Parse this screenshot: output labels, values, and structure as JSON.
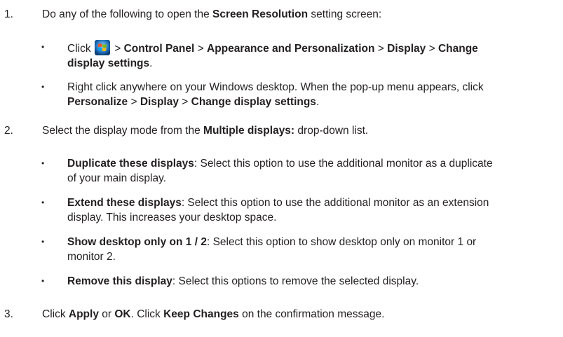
{
  "steps": [
    {
      "num": "1.",
      "pre": "Do any of the following to open the ",
      "bold": "Screen Resolution",
      "post": " setting screen:",
      "bullets": [
        {
          "lines": [
            [
              {
                "t": "Click ",
                "b": false
              },
              {
                "icon": "windows-start-icon"
              },
              {
                "t": " > ",
                "b": false
              },
              {
                "t": "Control Panel",
                "b": true
              },
              {
                "t": " > ",
                "b": false
              },
              {
                "t": "Appearance and Personalization",
                "b": true
              },
              {
                "t": " > ",
                "b": false
              },
              {
                "t": "Display",
                "b": true
              },
              {
                "t": " > ",
                "b": false
              },
              {
                "t": "Change",
                "b": true
              }
            ],
            [
              {
                "t": "display settings",
                "b": true
              },
              {
                "t": ".",
                "b": false
              }
            ]
          ]
        },
        {
          "lines": [
            [
              {
                "t": "Right click anywhere on your Windows desktop. When the pop-up menu appears, click",
                "b": false
              }
            ],
            [
              {
                "t": "Personalize",
                "b": true
              },
              {
                "t": " > ",
                "b": false
              },
              {
                "t": "Display",
                "b": true
              },
              {
                "t": " > ",
                "b": false
              },
              {
                "t": "Change display settings",
                "b": true
              },
              {
                "t": ".",
                "b": false
              }
            ]
          ]
        }
      ]
    },
    {
      "num": "2.",
      "pre": "Select the display mode from the ",
      "bold": "Multiple displays:",
      "post": " drop-down list.",
      "bullets": [
        {
          "lines": [
            [
              {
                "t": "Duplicate these displays",
                "b": true
              },
              {
                "t": ": Select this option to use the additional monitor as a duplicate",
                "b": false
              }
            ],
            [
              {
                "t": "of your main display.",
                "b": false
              }
            ]
          ]
        },
        {
          "lines": [
            [
              {
                "t": "Extend these displays",
                "b": true
              },
              {
                "t": ": Select this option to use the additional monitor as an extension",
                "b": false
              }
            ],
            [
              {
                "t": "display. This increases your desktop space.",
                "b": false
              }
            ]
          ]
        },
        {
          "lines": [
            [
              {
                "t": "Show desktop only on 1 / 2",
                "b": true
              },
              {
                "t": ": Select this option to show desktop only on monitor 1 or",
                "b": false
              }
            ],
            [
              {
                "t": "monitor 2.",
                "b": false
              }
            ]
          ]
        },
        {
          "lines": [
            [
              {
                "t": "Remove this display",
                "b": true
              },
              {
                "t": ": Select this options to remove the selected display.",
                "b": false
              }
            ]
          ]
        }
      ]
    },
    {
      "num": "3.",
      "segments": [
        {
          "t": "Click ",
          "b": false
        },
        {
          "t": "Apply",
          "b": true
        },
        {
          "t": " or ",
          "b": false
        },
        {
          "t": "OK",
          "b": true
        },
        {
          "t": ". Click ",
          "b": false
        },
        {
          "t": "Keep Changes",
          "b": true
        },
        {
          "t": " on the confirmation message.",
          "b": false
        }
      ]
    }
  ],
  "bullet_char": "•"
}
